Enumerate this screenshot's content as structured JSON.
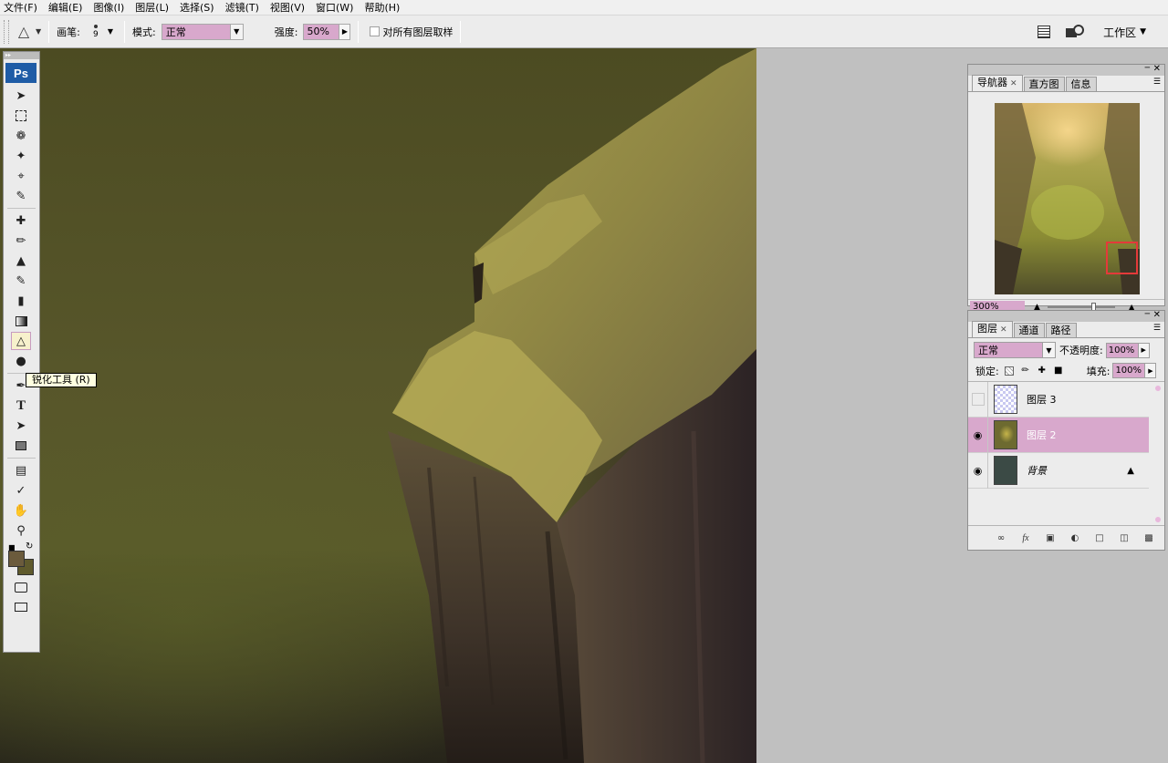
{
  "menu": [
    "文件(F)",
    "编辑(E)",
    "图像(I)",
    "图层(L)",
    "选择(S)",
    "滤镜(T)",
    "视图(V)",
    "窗口(W)",
    "帮助(H)"
  ],
  "options": {
    "brush_label": "画笔:",
    "brush_size": "9",
    "mode_label": "模式:",
    "mode_value": "正常",
    "strength_label": "强度:",
    "strength_value": "50%",
    "sample_all_label": "对所有图层取样",
    "workspace_label": "工作区"
  },
  "toolbox": {
    "logo": "Ps",
    "active_tool": "sharpen",
    "foreground_color": "#6b5b3c",
    "background_color": "#5f5a2c"
  },
  "tooltip": "锐化工具 (R)",
  "navigator": {
    "tabs": [
      "导航器",
      "直方图",
      "信息"
    ],
    "zoom": "300%"
  },
  "layers": {
    "tabs": [
      "图层",
      "通道",
      "路径"
    ],
    "blend_mode": "正常",
    "opacity_label": "不透明度:",
    "opacity_value": "100%",
    "lock_label": "锁定:",
    "fill_label": "填充:",
    "fill_value": "100%",
    "items": [
      {
        "name": "图层 3",
        "visible": false,
        "selected": false
      },
      {
        "name": "图层 2",
        "visible": true,
        "selected": true
      },
      {
        "name": "背景",
        "visible": true,
        "selected": false,
        "locked": true
      }
    ]
  },
  "colors": {
    "accent": "#d8a8cc",
    "panel_bg": "#ececec",
    "nav_view_box": "#e43a3a"
  }
}
